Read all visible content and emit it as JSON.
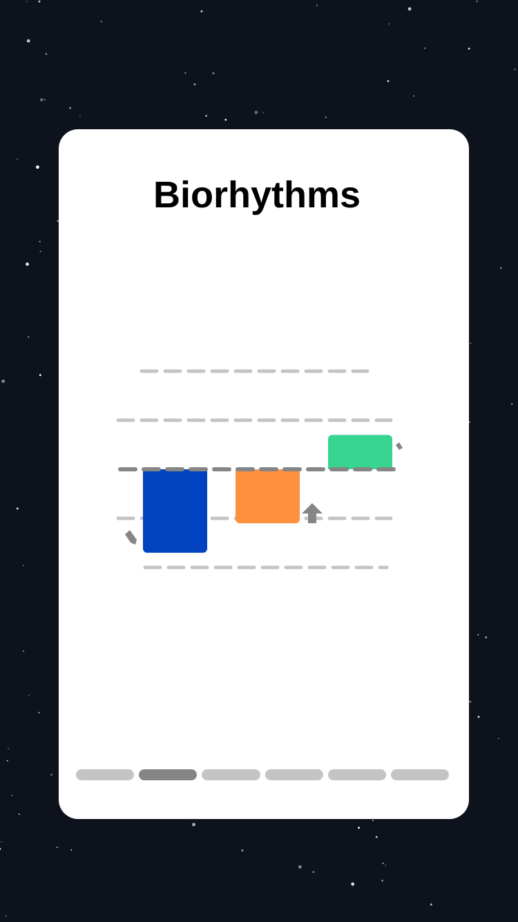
{
  "screen": {
    "background_color": "#0d121c",
    "star_color": "#ffffff"
  },
  "card": {
    "title": "Biorhythms",
    "background_color": "#ffffff"
  },
  "chart_data": {
    "type": "bar",
    "categories": [
      "",
      "",
      ""
    ],
    "series": [
      {
        "values": [
          -0.85,
          -0.55,
          0.35
        ],
        "colors": [
          "#0042c0",
          "#fe913e",
          "#37d591"
        ]
      }
    ],
    "ylim": [
      -1,
      1
    ],
    "baseline": 0,
    "grid": true,
    "grid_style": "dashed",
    "baseline_color": "#858585",
    "grid_color": "#c4c4c4",
    "indicators": [
      {
        "name": "arrow-down-left-icon"
      },
      {
        "name": "arrow-up-icon"
      },
      {
        "name": "arrow-down-right-icon"
      }
    ]
  },
  "pager": {
    "count": 6,
    "active_index": 1,
    "active_color": "#858585",
    "inactive_color": "#c4c4c4"
  }
}
